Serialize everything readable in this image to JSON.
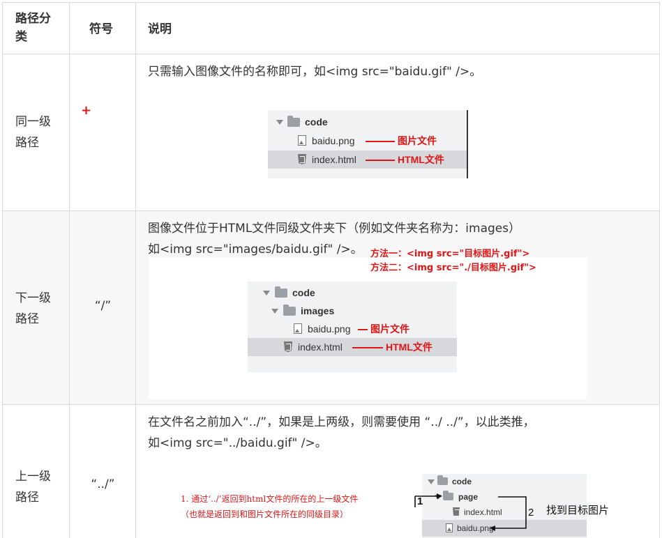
{
  "header": {
    "col1": "路径分类",
    "col1_line1": "路径分",
    "col1_line2": "类",
    "col2": "符号",
    "col3": "说明"
  },
  "rows": [
    {
      "category_line1": "同一级",
      "category_line2": "路径",
      "symbol": "",
      "marker": "+",
      "desc_line1": "只需输入图像文件的名称即可，如<img src=\"baidu.gif\" />。",
      "tree": {
        "folder": "code",
        "file1": "baidu.png",
        "file1_note": "图片文件",
        "file2": "index.html",
        "file2_note": "HTML文件"
      }
    },
    {
      "category_line1": "下一级",
      "category_line2": "路径",
      "symbol": "“/”",
      "desc_line1": "图像文件位于HTML文件同级文件夹下（例如文件夹名称为：images）",
      "desc_line2": "如<img src=\"images/baidu.gif\" />。",
      "method1": "方法一：<img src=\"目标图片.gif\">",
      "method2": "方法二：<img src=\"./目标图片.gif\">",
      "tree": {
        "folder": "code",
        "subfolder": "images",
        "file1": "baidu.png",
        "file1_note": "图片文件",
        "file2": "index.html",
        "file2_note": "HTML文件"
      }
    },
    {
      "category_line1": "上一级",
      "category_line2": "路径",
      "symbol": "“../”",
      "desc_line1": "在文件名之前加入“../”，如果是上两级，则需要使用 “../ ../”，以此类推，",
      "desc_line2": "如<img src=\"../baidu.gif\" />。",
      "note_line1": "1. 通过‘../’返回到html文件的所在的上一级文件",
      "note_line2": "（也就是返回到和图片文件所在的同级目录）",
      "step1": "1",
      "step2": "2",
      "find_label": "找到目标图片",
      "tree": {
        "folder": "code",
        "subfolder": "page",
        "file1": "index.html",
        "file2": "baidu.png"
      }
    }
  ],
  "colors": {
    "red": "#e01515",
    "border": "#d9d9d9",
    "panel": "#f1f2f3",
    "selected": "#d6d8db"
  }
}
